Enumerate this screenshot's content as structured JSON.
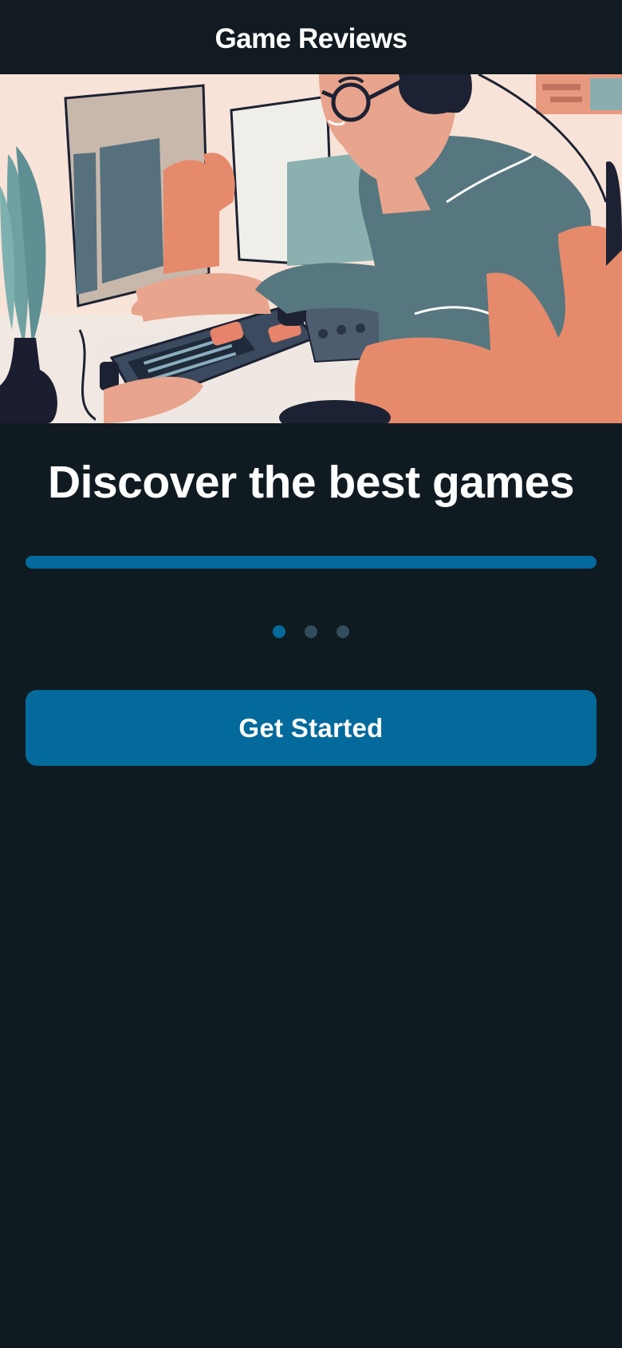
{
  "header": {
    "title": "Game Reviews"
  },
  "hero": {
    "illustration": "person-gaming-at-computer-illustration"
  },
  "onboarding": {
    "headline": "Discover the best games",
    "progress_fraction": 1.0,
    "page_count": 3,
    "current_page": 1,
    "cta_label": "Get Started"
  },
  "colors": {
    "background": "#101b21",
    "accent": "#046a9c",
    "dot_inactive": "#314e5e",
    "text": "#ffffff"
  }
}
